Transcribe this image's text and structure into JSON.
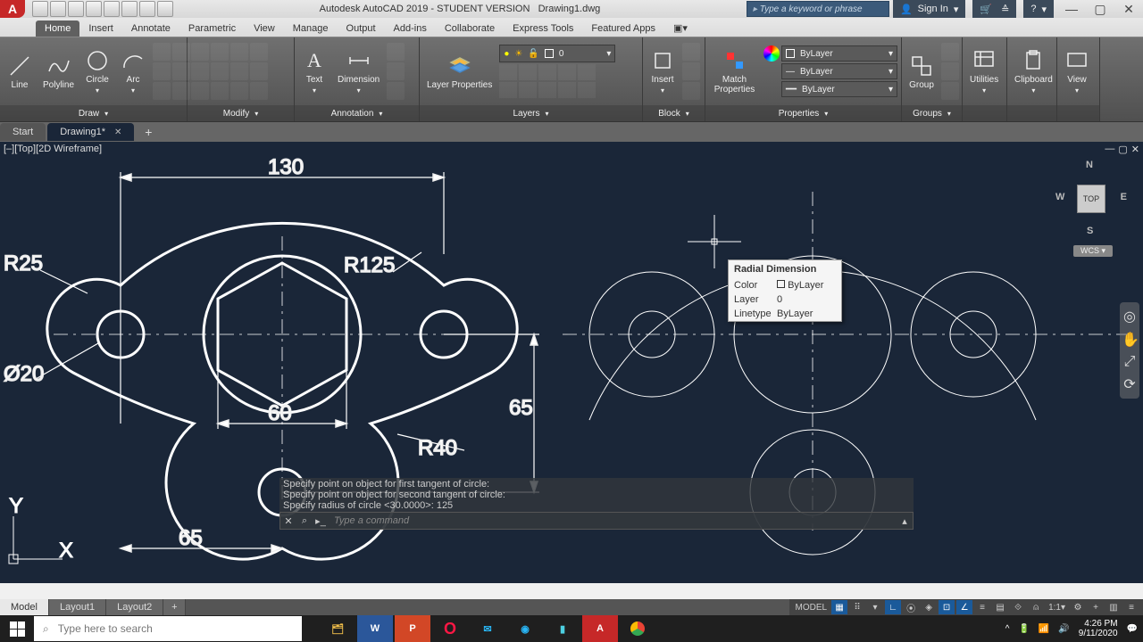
{
  "title": {
    "app": "Autodesk AutoCAD 2019 - STUDENT VERSION",
    "doc": "Drawing1.dwg",
    "search_placeholder": "Type a keyword or phrase",
    "sign_in": "Sign In"
  },
  "ribbon": {
    "tabs": [
      "Home",
      "Insert",
      "Annotate",
      "Parametric",
      "View",
      "Manage",
      "Output",
      "Add-ins",
      "Collaborate",
      "Express Tools",
      "Featured Apps"
    ],
    "panels": {
      "draw": {
        "title": "Draw",
        "buttons": [
          "Line",
          "Polyline",
          "Circle",
          "Arc"
        ]
      },
      "modify": {
        "title": "Modify"
      },
      "annotation": {
        "title": "Annotation",
        "buttons": [
          "Text",
          "Dimension"
        ]
      },
      "layers": {
        "title": "Layers",
        "button": "Layer Properties",
        "current": "0"
      },
      "block": {
        "title": "Block",
        "buttons": [
          "Insert"
        ]
      },
      "properties": {
        "title": "Properties",
        "button": "Match Properties",
        "combo": "ByLayer"
      },
      "groups": {
        "title": "Groups",
        "button": "Group"
      },
      "utilities": {
        "title": "Utilities"
      },
      "clipboard": {
        "title": "Clipboard"
      },
      "view": {
        "title": "View"
      }
    }
  },
  "file_tabs": {
    "start": "Start",
    "active": "Drawing1*"
  },
  "viewport": {
    "label": "[–][Top][2D Wireframe]"
  },
  "chart_data": {
    "type": "diagram",
    "dimensions": {
      "width_top": "130",
      "hex_width": "60",
      "height_right": "65",
      "height_left": "65",
      "r_top_left": "R25",
      "r_big": "R125",
      "r_bottom": "R40",
      "dia_small": "Ø20"
    }
  },
  "tooltip": {
    "title": "Radial Dimension",
    "rows": {
      "Color": "ByLayer",
      "Layer": "0",
      "Linetype": "ByLayer"
    }
  },
  "viewcube": {
    "face": "TOP",
    "n": "N",
    "s": "S",
    "e": "E",
    "w": "W",
    "wcs": "WCS"
  },
  "command": {
    "hist1": "Specify point on object for first tangent of circle:",
    "hist2": "Specify point on object for second tangent of circle:",
    "hist3": "Specify radius of circle <30.0000>: 125",
    "placeholder": "Type a command"
  },
  "layout_tabs": [
    "Model",
    "Layout1",
    "Layout2"
  ],
  "status": {
    "model": "MODEL",
    "scale": "1:1"
  },
  "taskbar": {
    "search": "Type here to search",
    "time": "4:26 PM",
    "date": "9/11/2020"
  }
}
